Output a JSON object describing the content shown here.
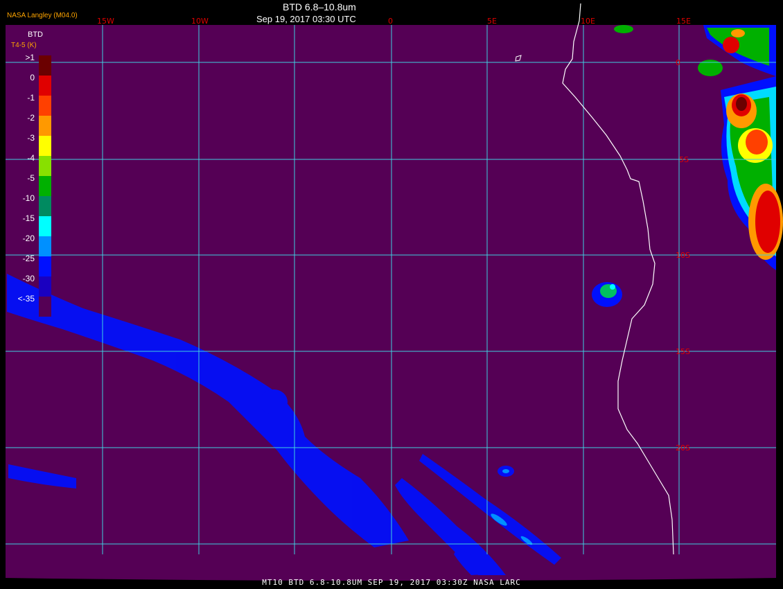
{
  "header": {
    "title": "BTD 6.8–10.8um",
    "datetime": "Sep 19, 2017 03:30 UTC",
    "brand": "NASA Langley (M04.0)"
  },
  "footer": {
    "text": "MT10   BTD 6.8-10.8UM   SEP 19, 2017 03:30Z   NASA LARC"
  },
  "legend": {
    "title": "BTD",
    "subtitle": "T4-5 (K)",
    "entries": [
      {
        "label": ">1",
        "color": "#6b0000"
      },
      {
        "label": "0",
        "color": "#e00000"
      },
      {
        "label": "-1",
        "color": "#ff4000"
      },
      {
        "label": "-2",
        "color": "#ff9900"
      },
      {
        "label": "-3",
        "color": "#ffff00"
      },
      {
        "label": "-4",
        "color": "#88e000"
      },
      {
        "label": "-5",
        "color": "#00b000"
      },
      {
        "label": "-10",
        "color": "#008a60"
      },
      {
        "label": "-15",
        "color": "#00ffff"
      },
      {
        "label": "-20",
        "color": "#0090ff"
      },
      {
        "label": "-25",
        "color": "#0010ff"
      },
      {
        "label": "-30",
        "color": "#1a00c0"
      },
      {
        "label": "<-35",
        "color": "#550055"
      }
    ]
  },
  "grid": {
    "longitude_labels": [
      "15W",
      "10W",
      "0",
      "5E",
      "10E",
      "15E"
    ],
    "latitude_labels": [
      "0",
      "5S",
      "10S",
      "15S",
      "20S"
    ]
  },
  "colors": {
    "background": "#550055",
    "grid_line": "#40d0e0",
    "coastline": "#ffffff",
    "label": "#e00000"
  }
}
